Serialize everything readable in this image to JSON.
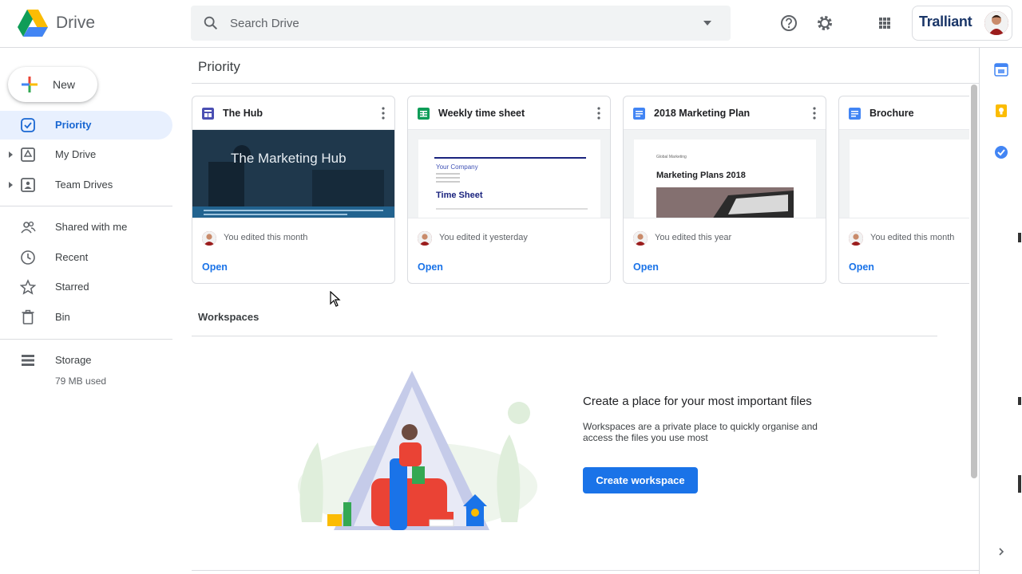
{
  "header": {
    "brand": "Drive",
    "search_placeholder": "Search Drive",
    "account_name": "Tralliant"
  },
  "sidebar": {
    "new_label": "New",
    "items": [
      {
        "label": "Priority",
        "icon": "priority-icon",
        "active": true
      },
      {
        "label": "My Drive",
        "icon": "my-drive-icon"
      },
      {
        "label": "Team Drives",
        "icon": "team-drives-icon"
      },
      {
        "label": "Shared with me",
        "icon": "shared-icon"
      },
      {
        "label": "Recent",
        "icon": "clock-icon"
      },
      {
        "label": "Starred",
        "icon": "star-icon"
      },
      {
        "label": "Bin",
        "icon": "trash-icon"
      },
      {
        "label": "Storage",
        "icon": "storage-icon"
      }
    ],
    "storage_used": "79 MB used"
  },
  "main": {
    "priority_title": "Priority",
    "cards": [
      {
        "title": "The Hub",
        "type": "sites",
        "edited": "You edited this month",
        "open": "Open",
        "thumb_text": "The Marketing Hub"
      },
      {
        "title": "Weekly time sheet",
        "type": "sheets",
        "edited": "You edited it yesterday",
        "open": "Open",
        "thumb_company": "Your Company",
        "thumb_heading": "Time Sheet"
      },
      {
        "title": "2018 Marketing Plan",
        "type": "docs",
        "edited": "You edited this year",
        "open": "Open",
        "thumb_small": "Global Marketing",
        "thumb_heading": "Marketing Plans 2018"
      },
      {
        "title": "Brochure",
        "type": "docs",
        "edited": "You edited this month",
        "open": "Open"
      }
    ],
    "workspaces_title": "Workspaces",
    "workspace_heading": "Create a place for your most important files",
    "workspace_desc": "Workspaces are a private place to quickly organise and access the files you use most",
    "workspace_button": "Create workspace"
  },
  "colors": {
    "accent": "#1a73e8",
    "active_bg": "#e8f0fe",
    "sites": "#4a4fb3",
    "sheets": "#0f9d58",
    "docs": "#4285f4"
  }
}
